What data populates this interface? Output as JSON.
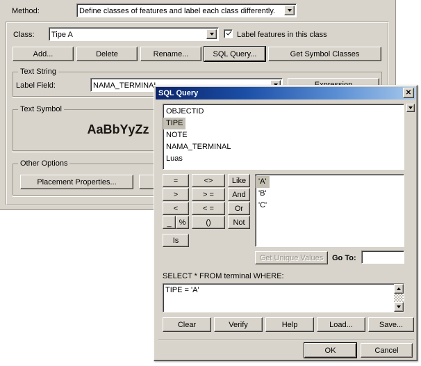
{
  "main_window": {
    "method": {
      "label": "Method:",
      "value": "Define classes of features and label each class differently.",
      "dropdown_icon": "chevron-down-icon"
    },
    "class": {
      "label": "Class:",
      "value": "Tipe A",
      "dropdown_icon": "chevron-down-icon"
    },
    "label_features_checkbox": {
      "label": "Label features in this class",
      "checked": true,
      "icon": "checkmark-icon"
    },
    "class_buttons": [
      {
        "label": "Add...",
        "name": "add-button",
        "default": false
      },
      {
        "label": "Delete",
        "name": "delete-button",
        "default": false
      },
      {
        "label": "Rename...",
        "name": "rename-button",
        "default": false
      },
      {
        "label": "SQL Query...",
        "name": "sql-query-button",
        "default": true
      },
      {
        "label": "Get Symbol Classes",
        "name": "get-symbol-classes-button",
        "default": false
      }
    ],
    "text_string_group": {
      "title": "Text String",
      "label_field_label": "Label Field:",
      "label_field_value": "NAMA_TERMINAL",
      "expression_button": "Expression"
    },
    "text_symbol_group": {
      "title": "Text Symbol",
      "preview_text": "AaBbYyZz"
    },
    "other_options_group": {
      "title": "Other Options",
      "placement_button": "Placement Properties..."
    }
  },
  "sql_dialog": {
    "title": "SQL Query",
    "close_icon": "close-icon",
    "fields": [
      {
        "name": "OBJECTID",
        "selected": false
      },
      {
        "name": "TIPE",
        "selected": true
      },
      {
        "name": "NOTE",
        "selected": false
      },
      {
        "name": "NAMA_TERMINAL",
        "selected": false
      },
      {
        "name": "Luas",
        "selected": false
      }
    ],
    "operators": [
      {
        "label": "=",
        "name": "op-equals-button"
      },
      {
        "label": "<>",
        "name": "op-not-equals-button"
      },
      {
        "label": "Like",
        "name": "op-like-button"
      },
      {
        "label": ">",
        "name": "op-greater-button"
      },
      {
        "label": "> =",
        "name": "op-greater-equals-button"
      },
      {
        "label": "And",
        "name": "op-and-button"
      },
      {
        "label": "<",
        "name": "op-less-button"
      },
      {
        "label": "< =",
        "name": "op-less-equals-button"
      },
      {
        "label": "Or",
        "name": "op-or-button"
      },
      {
        "label": "()",
        "name": "op-parens-button"
      },
      {
        "label": "Not",
        "name": "op-not-button"
      }
    ],
    "wildcard_buttons": [
      {
        "label": "_",
        "name": "op-underscore-button"
      },
      {
        "label": "%",
        "name": "op-percent-button"
      }
    ],
    "is_button": {
      "label": "Is",
      "name": "op-is-button"
    },
    "values": [
      {
        "value": "'A'",
        "selected": true
      },
      {
        "value": "'B'",
        "selected": false
      },
      {
        "value": "'C'",
        "selected": false
      }
    ],
    "get_unique_values_button": {
      "label": "Get Unique Values",
      "enabled": false
    },
    "go_to": {
      "label": "Go To:",
      "value": ""
    },
    "select_statement_label": "SELECT * FROM terminal WHERE:",
    "query_text": "TIPE = 'A'",
    "action_buttons": [
      {
        "label": "Clear",
        "name": "clear-button"
      },
      {
        "label": "Verify",
        "name": "verify-button"
      },
      {
        "label": "Help",
        "name": "help-button"
      },
      {
        "label": "Load...",
        "name": "load-button"
      },
      {
        "label": "Save...",
        "name": "save-button"
      }
    ],
    "ok_button": {
      "label": "OK",
      "default": true
    },
    "cancel_button": {
      "label": "Cancel",
      "default": false
    }
  },
  "colors": {
    "dialog_face": "#d8d4cb",
    "title_start": "#0a246a",
    "title_end": "#a6c8ec",
    "selection": "#c3bfb3",
    "field_bg": "#ffffff"
  }
}
